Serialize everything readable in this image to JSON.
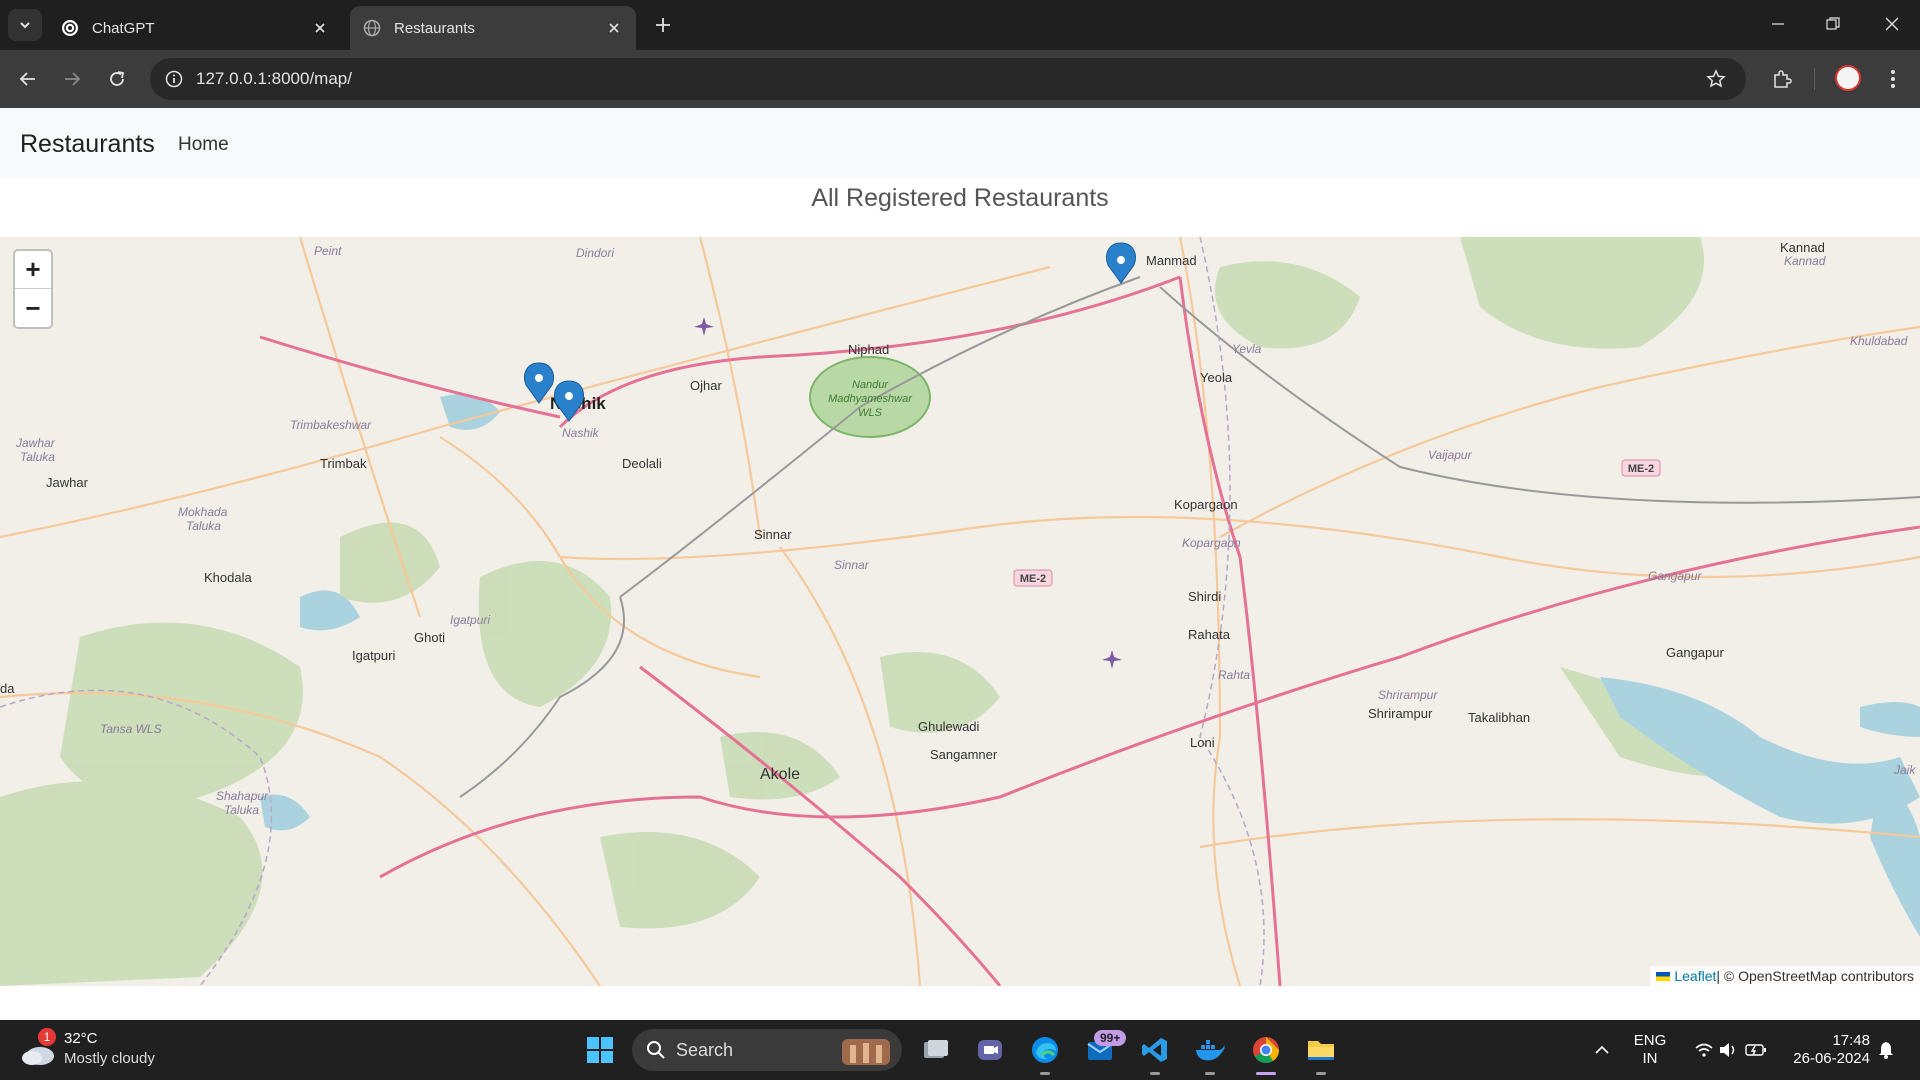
{
  "browser": {
    "tabs": [
      {
        "title": "ChatGPT",
        "active": false
      },
      {
        "title": "Restaurants",
        "active": true
      }
    ],
    "url": "127.0.0.1:8000/map/"
  },
  "page": {
    "brand": "Restaurants",
    "nav": {
      "home": "Home"
    },
    "heading": "All Registered Restaurants"
  },
  "map": {
    "place_labels": {
      "manmad": "Manmad",
      "kannad": "Kannad",
      "kannad_it": "Kannad",
      "peint": "Peint",
      "dindori": "Dindori",
      "ojhar": "Ojhar",
      "niphad": "Niphad",
      "nandur": "Nandur\nMadhyameshwar\nWLS",
      "yeola": "Yeola",
      "yevla_it": "Yevla",
      "khuldabad": "Khuldabad",
      "nashik": "Nashik",
      "nashik_it": "Nashik",
      "trimbakeshwar": "Trimbakeshwar",
      "trimbak": "Trimbak",
      "jawhar_taluka": "Jawhar\nTaluka",
      "jawhar": "Jawhar",
      "deolali": "Deolali",
      "vaijapur": "Vaijapur",
      "kopargaon": "Kopargaon",
      "kopargaon_it": "Kopargaon",
      "mokhada": "Mokhada\nTaluka",
      "khodala": "Khodala",
      "sinnar": "Sinnar",
      "sinnar_it": "Sinnar",
      "gangapur_it": "Gangapur",
      "gangapur": "Gangapur",
      "shirdi": "Shirdi",
      "rahata": "Rahata",
      "rahta_it": "Rahta",
      "igatpuri_it": "Igatpuri",
      "igatpuri": "Igatpuri",
      "ghoti": "Ghoti",
      "shrirampur_it": "Shrirampur",
      "shrirampur": "Shrirampur",
      "takalibhan": "Takalibhan",
      "tansa": "Tansa WLS",
      "ghulewadi": "Ghulewadi",
      "sangamner": "Sangamner",
      "loni": "Loni",
      "akole": "Akole",
      "shahapur": "Shahapur\nTaluka",
      "jaik": "Jaik",
      "da": "da"
    },
    "road_shields": [
      "ME-2",
      "ME-2"
    ],
    "markers_count": 3,
    "zoom_in": "+",
    "zoom_out": "−",
    "attribution": {
      "leaflet": "Leaflet",
      "rest": " | © OpenStreetMap contributors"
    }
  },
  "taskbar": {
    "weather": {
      "temp": "32°C",
      "condition": "Mostly cloudy",
      "badge": "1"
    },
    "search_label": "Search",
    "notif_badge": "99+",
    "lang": {
      "line1": "ENG",
      "line2": "IN"
    },
    "time": "17:48",
    "date": "26-06-2024"
  },
  "colors": {
    "accent_blue": "#2a81cb",
    "road_pink": "#e57294",
    "water": "#aad3df",
    "forest": "#add19e"
  }
}
